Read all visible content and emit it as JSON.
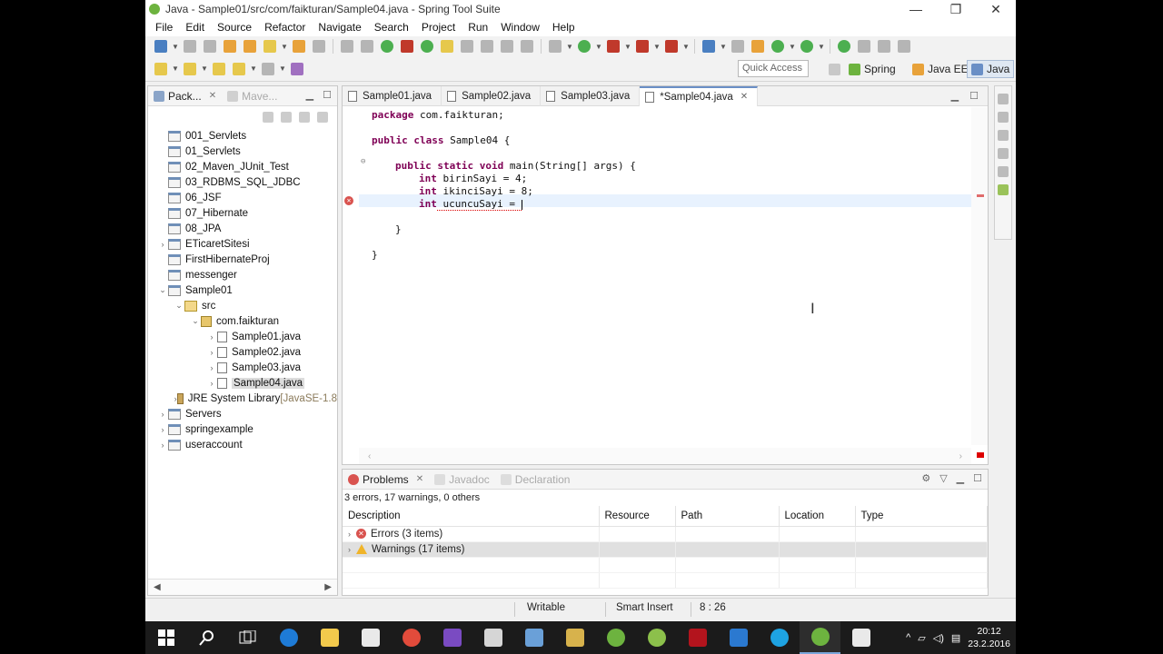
{
  "window": {
    "title": "Java - Sample01/src/com/faikturan/Sample04.java - Spring Tool Suite",
    "minimize": "—",
    "restore": "❐",
    "close": "✕"
  },
  "menu": [
    "File",
    "Edit",
    "Source",
    "Refactor",
    "Navigate",
    "Search",
    "Project",
    "Run",
    "Window",
    "Help"
  ],
  "toolbar": {
    "quick_access_placeholder": "Quick Access",
    "perspectives": [
      "Spring",
      "Java EE",
      "Java"
    ]
  },
  "package_explorer": {
    "tabs": [
      "Pack...",
      "Mave..."
    ],
    "tree": [
      {
        "label": "001_Servlets",
        "level": 0,
        "icon": "project-icon",
        "arrow": ""
      },
      {
        "label": "01_Servlets",
        "level": 0,
        "icon": "project-icon",
        "arrow": ""
      },
      {
        "label": "02_Maven_JUnit_Test",
        "level": 0,
        "icon": "project-icon",
        "arrow": ""
      },
      {
        "label": "03_RDBMS_SQL_JDBC",
        "level": 0,
        "icon": "project-icon",
        "arrow": ""
      },
      {
        "label": "06_JSF",
        "level": 0,
        "icon": "project-icon",
        "arrow": ""
      },
      {
        "label": "07_Hibernate",
        "level": 0,
        "icon": "project-icon",
        "arrow": ""
      },
      {
        "label": "08_JPA",
        "level": 0,
        "icon": "project-icon",
        "arrow": ""
      },
      {
        "label": "ETicaretSitesi",
        "level": 0,
        "icon": "project-icon",
        "arrow": ">"
      },
      {
        "label": "FirstHibernateProj",
        "level": 0,
        "icon": "project-icon",
        "arrow": ""
      },
      {
        "label": "messenger",
        "level": 0,
        "icon": "project-icon",
        "arrow": ""
      },
      {
        "label": "Sample01",
        "level": 0,
        "icon": "project-icon",
        "arrow": "v"
      },
      {
        "label": "src",
        "level": 1,
        "icon": "source-folder-icon",
        "arrow": "v"
      },
      {
        "label": "com.faikturan",
        "level": 2,
        "icon": "package-icon",
        "arrow": "v"
      },
      {
        "label": "Sample01.java",
        "level": 3,
        "icon": "java-file-icon",
        "arrow": ">"
      },
      {
        "label": "Sample02.java",
        "level": 3,
        "icon": "java-file-icon",
        "arrow": ">"
      },
      {
        "label": "Sample03.java",
        "level": 3,
        "icon": "java-file-icon",
        "arrow": ">"
      },
      {
        "label": "Sample04.java",
        "level": 3,
        "icon": "java-file-icon",
        "arrow": ">",
        "selected": true
      },
      {
        "label": "JRE System Library",
        "extra": " [JavaSE-1.8",
        "level": 1,
        "icon": "library-icon",
        "arrow": ">"
      },
      {
        "label": "Servers",
        "level": 0,
        "icon": "project-icon",
        "arrow": ">"
      },
      {
        "label": "springexample",
        "level": 0,
        "icon": "project-icon",
        "arrow": ">"
      },
      {
        "label": "useraccount",
        "level": 0,
        "icon": "project-icon",
        "arrow": ">"
      }
    ]
  },
  "editor": {
    "tabs": [
      {
        "label": "Sample01.java",
        "active": false
      },
      {
        "label": "Sample02.java",
        "active": false
      },
      {
        "label": "Sample03.java",
        "active": false
      },
      {
        "label": "*Sample04.java",
        "active": true
      }
    ],
    "code": [
      {
        "kw": "package",
        "text": " com.faikturan;",
        "indent": 0
      },
      {
        "kw": "",
        "text": "",
        "indent": 0
      },
      {
        "kw": "public class",
        "text": " Sample04 {",
        "indent": 0
      },
      {
        "kw": "",
        "text": "",
        "indent": 0
      },
      {
        "kw": "public static void",
        "text": " main(String[] args) {",
        "indent": 1
      },
      {
        "kw": "int",
        "text": " birinSayi = 4;",
        "indent": 2
      },
      {
        "kw": "int",
        "text": " ikinciSayi = 8;",
        "indent": 2
      },
      {
        "kw": "int",
        "text": " ucuncuSayi = ",
        "indent": 2
      },
      {
        "kw": "",
        "text": "",
        "indent": 0
      },
      {
        "kw": "",
        "text": "}",
        "indent": 1
      },
      {
        "kw": "",
        "text": "",
        "indent": 0
      },
      {
        "kw": "",
        "text": "}",
        "indent": 0
      }
    ]
  },
  "problems": {
    "tabs": [
      "Problems",
      "Javadoc",
      "Declaration"
    ],
    "summary": "3 errors, 17 warnings, 0 others",
    "columns": [
      "Description",
      "Resource",
      "Path",
      "Location",
      "Type"
    ],
    "rows": [
      {
        "label": "Errors (3 items)",
        "kind": "error"
      },
      {
        "label": "Warnings (17 items)",
        "kind": "warning"
      }
    ]
  },
  "statusbar": {
    "writable": "Writable",
    "insert_mode": "Smart Insert",
    "position": "8 : 26"
  },
  "taskbar": {
    "time": "20:12",
    "date": "23.2.2016"
  }
}
